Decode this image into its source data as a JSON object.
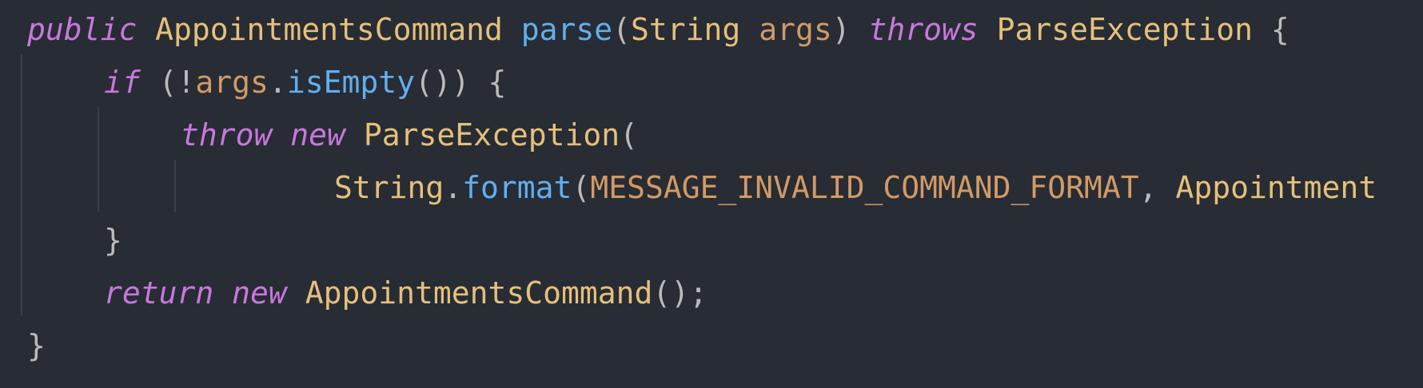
{
  "code": {
    "line1": {
      "kw_public": "public",
      "class_name": "AppointmentsCommand",
      "method": "parse",
      "open_paren": "(",
      "param_type": "String",
      "param_name": "args",
      "close_paren": ")",
      "kw_throws": "throws",
      "exception": "ParseException",
      "brace": "{"
    },
    "line2": {
      "kw_if": "if",
      "open": "(!",
      "var": "args",
      "dot": ".",
      "method": "isEmpty",
      "close": "()) {"
    },
    "line3": {
      "kw_throw": "throw",
      "kw_new": "new",
      "exception": "ParseException",
      "open": "("
    },
    "line4": {
      "type": "String",
      "dot": ".",
      "method": "format",
      "open": "(",
      "constant": "MESSAGE_INVALID_COMMAND_FORMAT",
      "comma": ",",
      "class_ref": "Appointment"
    },
    "line5": {
      "brace": "}"
    },
    "line6": {
      "kw_return": "return",
      "kw_new": "new",
      "class_name": "AppointmentsCommand",
      "end": "();"
    },
    "line7": {
      "brace": "}"
    }
  },
  "colors": {
    "background": "#282c34",
    "keyword": "#c678dd",
    "type": "#e5c07b",
    "function": "#61afef",
    "variable": "#d19a66",
    "punctuation": "#bbbbbb"
  }
}
